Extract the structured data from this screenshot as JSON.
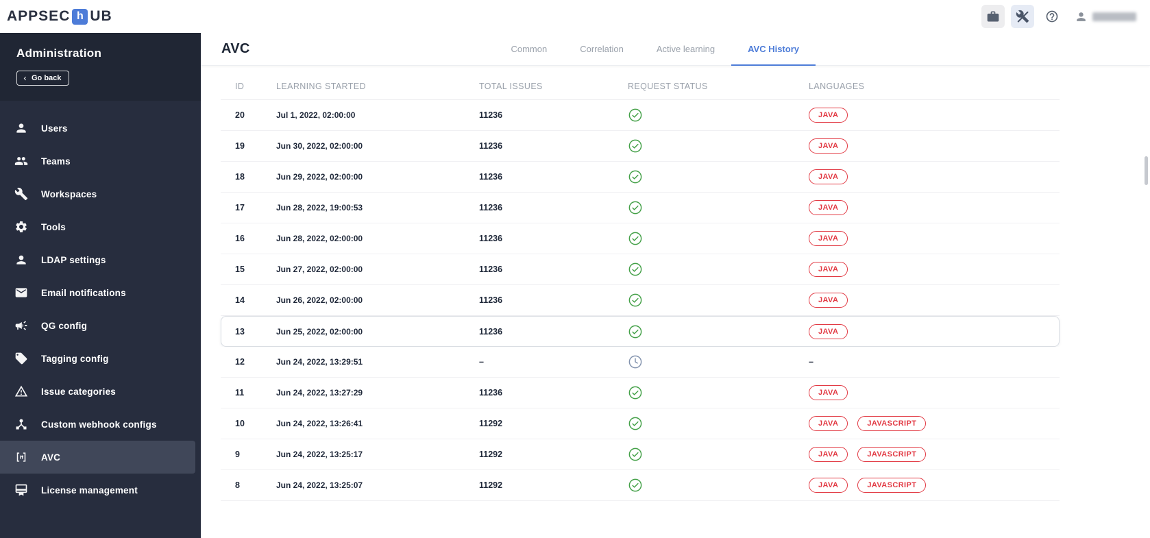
{
  "colors": {
    "accent": "#4d7cd8",
    "success": "#43a047",
    "pending": "#8292ad",
    "chip": "#e23a44",
    "sidebar_bg": "#272d3e",
    "sidebar_head_bg": "#202634",
    "sidebar_active_bg": "#404759"
  },
  "header": {
    "logo_prefix": "APPSEC",
    "logo_mid": "h",
    "logo_suffix": "UB"
  },
  "sidebar": {
    "title": "Administration",
    "go_back_label": "Go back",
    "items": [
      {
        "label": "Users",
        "icon": "user-icon",
        "active": false
      },
      {
        "label": "Teams",
        "icon": "people-icon",
        "active": false
      },
      {
        "label": "Workspaces",
        "icon": "wrench-icon",
        "active": false
      },
      {
        "label": "Tools",
        "icon": "gear-icon",
        "active": false
      },
      {
        "label": "LDAP settings",
        "icon": "person-card-icon",
        "active": false
      },
      {
        "label": "Email notifications",
        "icon": "mail-icon",
        "active": false
      },
      {
        "label": "QG config",
        "icon": "megaphone-icon",
        "active": false
      },
      {
        "label": "Tagging config",
        "icon": "tag-icon",
        "active": false
      },
      {
        "label": "Issue categories",
        "icon": "warning-icon",
        "active": false
      },
      {
        "label": "Custom webhook configs",
        "icon": "hub-icon",
        "active": false
      },
      {
        "label": "AVC",
        "icon": "avc-brackets-icon",
        "active": true
      },
      {
        "label": "License management",
        "icon": "license-icon",
        "active": false
      }
    ]
  },
  "main": {
    "title": "AVC",
    "tabs": [
      {
        "label": "Common",
        "active": false
      },
      {
        "label": "Correlation",
        "active": false
      },
      {
        "label": "Active learning",
        "active": false
      },
      {
        "label": "AVC History",
        "active": true
      }
    ],
    "table": {
      "columns": [
        "ID",
        "LEARNING STARTED",
        "TOTAL ISSUES",
        "REQUEST STATUS",
        "LANGUAGES"
      ],
      "empty_value": "–",
      "rows": [
        {
          "id": "20",
          "started": "Jul 1, 2022, 02:00:00",
          "issues": "11236",
          "status": "success",
          "languages": [
            "JAVA"
          ],
          "highlighted": false
        },
        {
          "id": "19",
          "started": "Jun 30, 2022, 02:00:00",
          "issues": "11236",
          "status": "success",
          "languages": [
            "JAVA"
          ],
          "highlighted": false
        },
        {
          "id": "18",
          "started": "Jun 29, 2022, 02:00:00",
          "issues": "11236",
          "status": "success",
          "languages": [
            "JAVA"
          ],
          "highlighted": false
        },
        {
          "id": "17",
          "started": "Jun 28, 2022, 19:00:53",
          "issues": "11236",
          "status": "success",
          "languages": [
            "JAVA"
          ],
          "highlighted": false
        },
        {
          "id": "16",
          "started": "Jun 28, 2022, 02:00:00",
          "issues": "11236",
          "status": "success",
          "languages": [
            "JAVA"
          ],
          "highlighted": false
        },
        {
          "id": "15",
          "started": "Jun 27, 2022, 02:00:00",
          "issues": "11236",
          "status": "success",
          "languages": [
            "JAVA"
          ],
          "highlighted": false
        },
        {
          "id": "14",
          "started": "Jun 26, 2022, 02:00:00",
          "issues": "11236",
          "status": "success",
          "languages": [
            "JAVA"
          ],
          "highlighted": false
        },
        {
          "id": "13",
          "started": "Jun 25, 2022, 02:00:00",
          "issues": "11236",
          "status": "success",
          "languages": [
            "JAVA"
          ],
          "highlighted": true
        },
        {
          "id": "12",
          "started": "Jun 24, 2022, 13:29:51",
          "issues": "–",
          "status": "pending",
          "languages": [],
          "highlighted": false
        },
        {
          "id": "11",
          "started": "Jun 24, 2022, 13:27:29",
          "issues": "11236",
          "status": "success",
          "languages": [
            "JAVA"
          ],
          "highlighted": false
        },
        {
          "id": "10",
          "started": "Jun 24, 2022, 13:26:41",
          "issues": "11292",
          "status": "success",
          "languages": [
            "JAVA",
            "JAVASCRIPT"
          ],
          "highlighted": false
        },
        {
          "id": "9",
          "started": "Jun 24, 2022, 13:25:17",
          "issues": "11292",
          "status": "success",
          "languages": [
            "JAVA",
            "JAVASCRIPT"
          ],
          "highlighted": false
        },
        {
          "id": "8",
          "started": "Jun 24, 2022, 13:25:07",
          "issues": "11292",
          "status": "success",
          "languages": [
            "JAVA",
            "JAVASCRIPT"
          ],
          "highlighted": false
        }
      ]
    }
  }
}
